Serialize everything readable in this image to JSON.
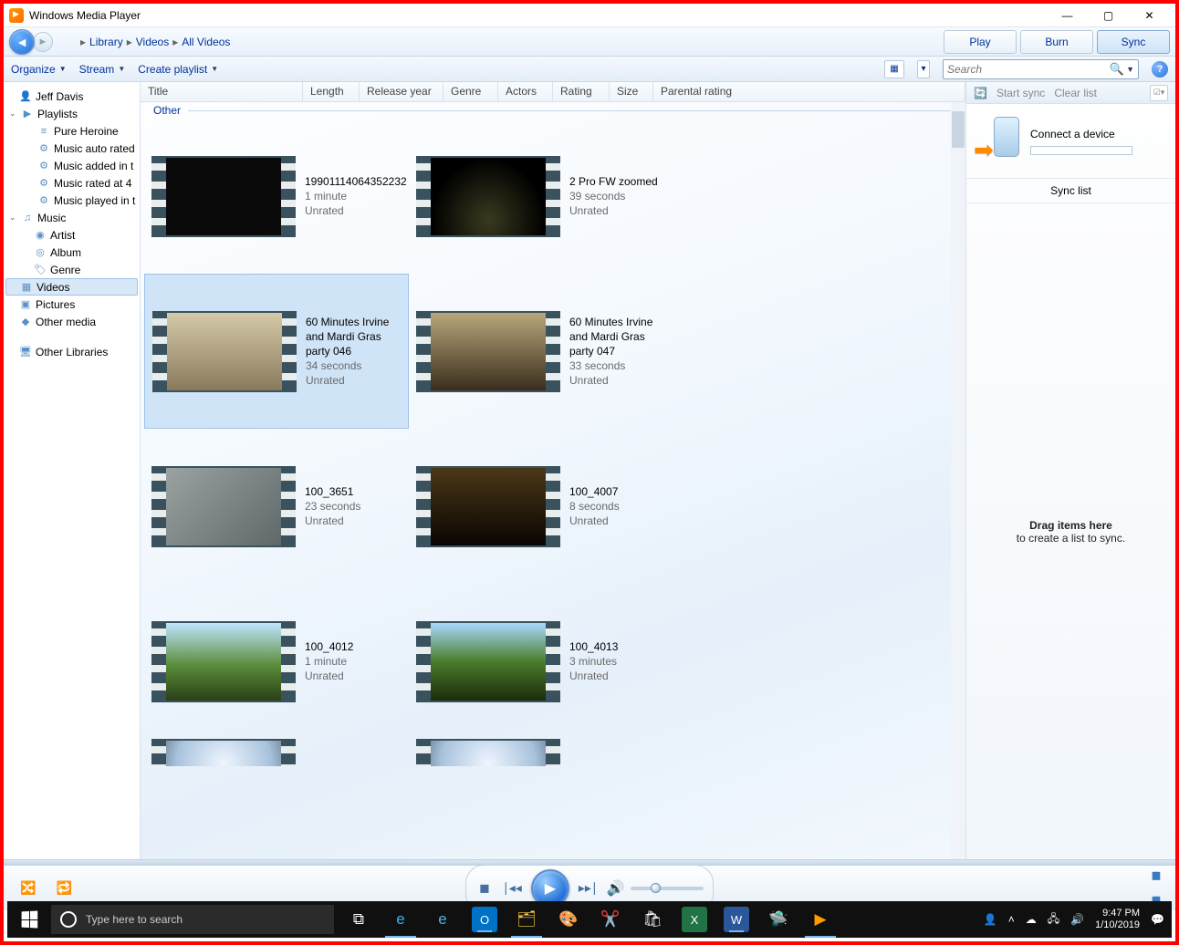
{
  "window": {
    "title": "Windows Media Player"
  },
  "breadcrumb": [
    "Library",
    "Videos",
    "All Videos"
  ],
  "tabs": {
    "play": "Play",
    "burn": "Burn",
    "sync": "Sync",
    "active": "sync"
  },
  "toolbar": {
    "organize": "Organize",
    "stream": "Stream",
    "create": "Create playlist"
  },
  "search": {
    "placeholder": "Search"
  },
  "syncbar": {
    "start": "Start sync",
    "clear": "Clear list"
  },
  "columns": [
    "Title",
    "Length",
    "Release year",
    "Genre",
    "Actors",
    "Rating",
    "Size",
    "Parental rating"
  ],
  "group": "Other",
  "tree": {
    "user": "Jeff Davis",
    "playlists_label": "Playlists",
    "playlists": [
      "Pure Heroine",
      "Music auto rated",
      "Music added in t",
      "Music rated at 4",
      "Music played in t"
    ],
    "music_label": "Music",
    "music_children": [
      "Artist",
      "Album",
      "Genre"
    ],
    "videos": "Videos",
    "pictures": "Pictures",
    "other_media": "Other media",
    "other_libraries": "Other Libraries"
  },
  "items": [
    {
      "title": "19901114064352232",
      "dur": "1 minute",
      "rating": "Unrated",
      "thumb": "t-dark"
    },
    {
      "title": "2 Pro FW zoomed",
      "dur": "39 seconds",
      "rating": "Unrated",
      "thumb": "t-dark2"
    },
    {
      "title": "60 Minutes Irvine and Mardi Gras party 046",
      "dur": "34 seconds",
      "rating": "Unrated",
      "thumb": "t-room",
      "sel": true
    },
    {
      "title": "60 Minutes Irvine and Mardi Gras party 047",
      "dur": "33 seconds",
      "rating": "Unrated",
      "thumb": "t-room2"
    },
    {
      "title": "100_3651",
      "dur": "23 seconds",
      "rating": "Unrated",
      "thumb": "t-grey"
    },
    {
      "title": "100_4007",
      "dur": "8 seconds",
      "rating": "Unrated",
      "thumb": "t-dark3"
    },
    {
      "title": "100_4012",
      "dur": "1 minute",
      "rating": "Unrated",
      "thumb": "t-field"
    },
    {
      "title": "100_4013",
      "dur": "3 minutes",
      "rating": "Unrated",
      "thumb": "t-field2"
    }
  ],
  "syncpanel": {
    "connect": "Connect a device",
    "list_header": "Sync list",
    "drop_big": "Drag items here",
    "drop_small": "to create a list to sync."
  },
  "taskbar": {
    "search": "Type here to search",
    "time": "9:47 PM",
    "date": "1/10/2019"
  }
}
